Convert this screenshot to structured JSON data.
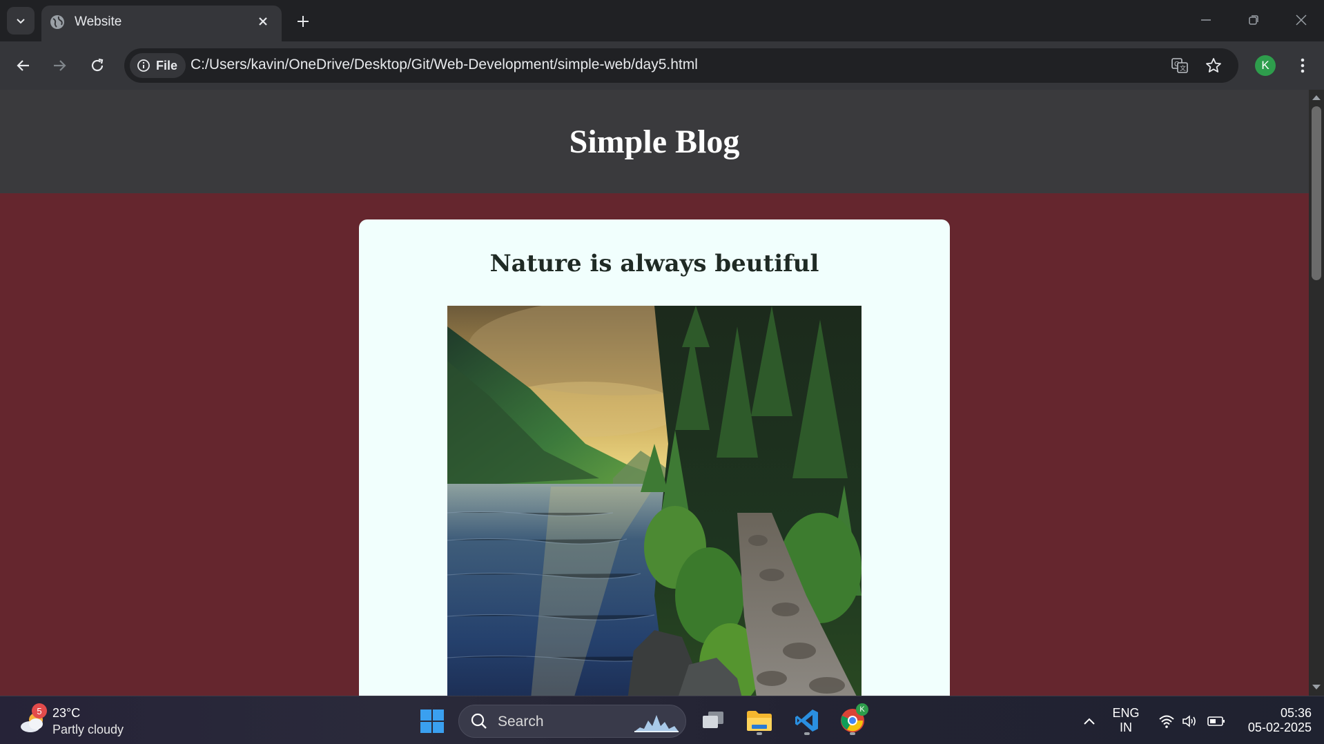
{
  "browser": {
    "tab": {
      "title": "Website"
    },
    "address_bar": {
      "site_chip_label": "File",
      "url": "C:/Users/kavin/OneDrive/Desktop/Git/Web-Development/simple-web/day5.html"
    },
    "profile_initial": "K"
  },
  "page": {
    "header_title": "Simple Blog",
    "post": {
      "title": "Nature is always beutiful"
    },
    "colors": {
      "header_bg": "#3a3a3d",
      "page_bg": "#65262e",
      "card_bg": "#f1fffd"
    }
  },
  "taskbar": {
    "weather": {
      "temp": "23°C",
      "desc": "Partly cloudy",
      "badge": "5"
    },
    "search_label": "Search",
    "chrome_badge": "K",
    "lang_top": "ENG",
    "lang_bottom": "IN",
    "time": "05:36",
    "date": "05-02-2025"
  }
}
